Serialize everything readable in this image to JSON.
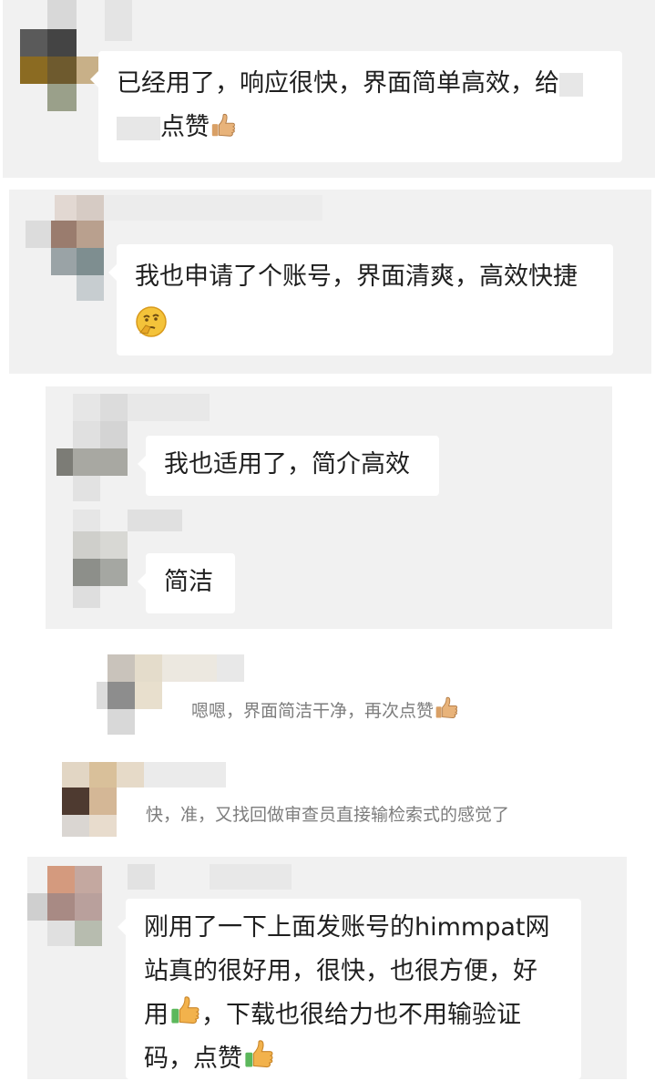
{
  "comments": [
    {
      "text": "已经用了，响应很快，界面简单高效，给",
      "text2": "点赞",
      "emoji": "thumbs-up-icon"
    },
    {
      "text": "我也申请了个账号，界面清爽，高效快捷",
      "emoji": "thinking-face-icon"
    },
    {
      "text": "我也适用了，简介高效"
    },
    {
      "text": "简洁"
    },
    {
      "text": "嗯嗯，界面简洁干净，再次点赞",
      "emoji": "thumbs-up-icon"
    },
    {
      "text": "快，准，又找回做审查员直接输检索式的感觉了"
    },
    {
      "line1": "刚用了一下上面发账号的himmpat网",
      "line2": "站真的很好用，很快，也很方便，好",
      "line3a": "用",
      "line3b": "，下载也很给力也不用输验证",
      "line4": "码，点赞",
      "emoji": "thumbs-up-icon"
    }
  ],
  "colors": {
    "panel": "#f1f1f1",
    "bubble": "#ffffff",
    "text": "#1f1f1f",
    "muted": "#7d7d7d"
  }
}
